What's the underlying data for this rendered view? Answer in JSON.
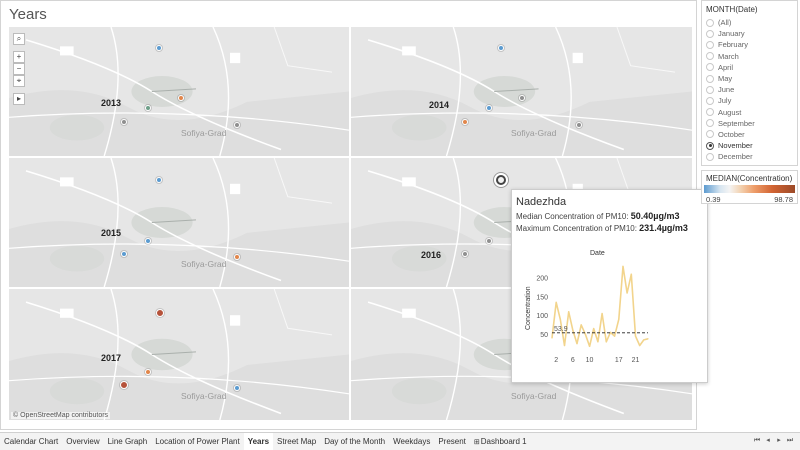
{
  "sheet": {
    "title": "Years",
    "credit": "© OpenStreetMap contributors",
    "city_label": "Sofiya-Grad"
  },
  "years": [
    "2013",
    "2014",
    "2015",
    "2016",
    "2017"
  ],
  "map_controls": [
    "search-icon",
    "zoom-in-icon",
    "zoom-out-icon",
    "lasso-icon",
    "expand-icon"
  ],
  "stations": {
    "colors": {
      "blue": "#5b9bd0",
      "gray": "#8f8f8f",
      "orange": "#e1864b",
      "red": "#b5523a",
      "green": "#6fa08a"
    }
  },
  "tooltip": {
    "name": "Nadezhda",
    "median_label": "Median Concentration of PM10:",
    "median_value": "50.40µg/m3",
    "max_label": "Maximum Concentration of PM10:",
    "max_value": "231.4µg/m3"
  },
  "chart_data": {
    "type": "line",
    "title": "Date",
    "xlabel": "",
    "ylabel": "Concentration",
    "x": [
      1,
      2,
      3,
      4,
      5,
      6,
      7,
      8,
      9,
      10,
      11,
      12,
      13,
      14,
      15,
      16,
      17,
      18,
      19,
      20,
      21,
      22,
      23,
      24
    ],
    "x_ticks": [
      "2",
      "6",
      "10",
      "17",
      "21"
    ],
    "x_tick_values": [
      2,
      6,
      10,
      17,
      21
    ],
    "series": [
      {
        "values": [
          40,
          135,
          90,
          20,
          110,
          60,
          25,
          75,
          50,
          18,
          65,
          30,
          105,
          30,
          55,
          45,
          90,
          231,
          160,
          210,
          45,
          20,
          35,
          38
        ]
      }
    ],
    "reference_line": {
      "value": 53.9,
      "label": "53.9"
    },
    "yticks": [
      50,
      100,
      150,
      200
    ],
    "ylim": [
      0,
      240
    ],
    "line_color": "#f2d48c"
  },
  "filter": {
    "title": "MONTH(Date)",
    "options": [
      "(All)",
      "January",
      "February",
      "March",
      "April",
      "May",
      "June",
      "July",
      "August",
      "September",
      "October",
      "November",
      "December"
    ],
    "selected": "November"
  },
  "legend": {
    "title": "MEDIAN(Concentration)",
    "min": "0.39",
    "max": "98.78"
  },
  "tabs": [
    {
      "label": "Calendar Chart"
    },
    {
      "label": "Overview"
    },
    {
      "label": "Line Graph"
    },
    {
      "label": "Location of Power Plant"
    },
    {
      "label": "Years",
      "active": true
    },
    {
      "label": "Street Map"
    },
    {
      "label": "Day of the Month"
    },
    {
      "label": "Weekdays"
    },
    {
      "label": "Present"
    },
    {
      "label": "Dashboard 1",
      "icon": "dashboard-icon"
    }
  ],
  "tab_nav": [
    "first-page-icon",
    "prev-page-icon",
    "next-page-icon",
    "last-page-icon"
  ]
}
